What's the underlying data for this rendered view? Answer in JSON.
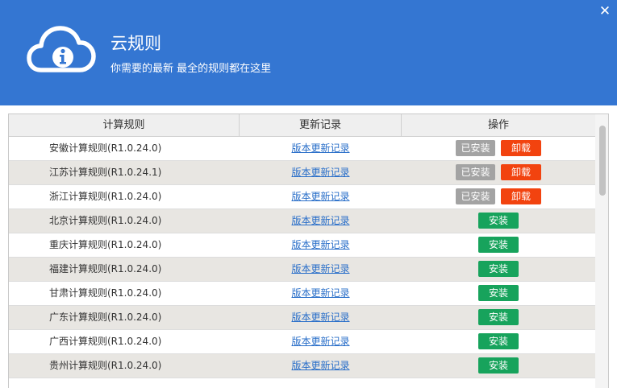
{
  "window": {
    "title": "云规则",
    "subtitle": "你需要的最新 最全的规则都在这里",
    "close_label": "✕"
  },
  "table": {
    "columns": [
      "计算规则",
      "更新记录",
      "操作"
    ],
    "rows": [
      {
        "name": "安徽计算规则(R1.0.24.0)",
        "link": "版本更新记录",
        "installed": true,
        "status_label": "已安装",
        "action_label": "卸载"
      },
      {
        "name": "江苏计算规则(R1.0.24.1)",
        "link": "版本更新记录",
        "installed": true,
        "status_label": "已安装",
        "action_label": "卸载"
      },
      {
        "name": "浙江计算规则(R1.0.24.0)",
        "link": "版本更新记录",
        "installed": true,
        "status_label": "已安装",
        "action_label": "卸载"
      },
      {
        "name": "北京计算规则(R1.0.24.0)",
        "link": "版本更新记录",
        "installed": false,
        "action_label": "安装"
      },
      {
        "name": "重庆计算规则(R1.0.24.0)",
        "link": "版本更新记录",
        "installed": false,
        "action_label": "安装"
      },
      {
        "name": "福建计算规则(R1.0.24.0)",
        "link": "版本更新记录",
        "installed": false,
        "action_label": "安装"
      },
      {
        "name": "甘肃计算规则(R1.0.24.0)",
        "link": "版本更新记录",
        "installed": false,
        "action_label": "安装"
      },
      {
        "name": "广东计算规则(R1.0.24.0)",
        "link": "版本更新记录",
        "installed": false,
        "action_label": "安装"
      },
      {
        "name": "广西计算规则(R1.0.24.0)",
        "link": "版本更新记录",
        "installed": false,
        "action_label": "安装"
      },
      {
        "name": "贵州计算规则(R1.0.24.0)",
        "link": "版本更新记录",
        "installed": false,
        "action_label": "安装"
      }
    ]
  },
  "icons": {
    "logo": "cloud-info-icon",
    "close": "close-icon"
  },
  "colors": {
    "header": "#3476d2",
    "installed_badge": "#a3a3a3",
    "uninstall_button": "#f2430f",
    "install_button": "#17a35c",
    "link": "#2a6fc9",
    "alt_row": "#e8e6e2"
  }
}
